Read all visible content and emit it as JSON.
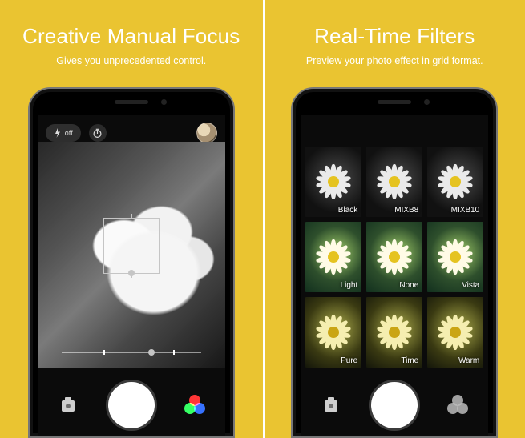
{
  "panels": [
    {
      "headline": "Creative Manual Focus",
      "subline": "Gives you unprecedented control.",
      "flash_label": "off"
    },
    {
      "headline": "Real-Time Filters",
      "subline": "Preview your photo effect in grid format."
    }
  ],
  "filters": [
    {
      "label": "Black",
      "tone": "dark"
    },
    {
      "label": "MIXB8",
      "tone": "dark"
    },
    {
      "label": "MIXB10",
      "tone": "dark"
    },
    {
      "label": "Light",
      "tone": "color"
    },
    {
      "label": "None",
      "tone": "color"
    },
    {
      "label": "Vista",
      "tone": "color"
    },
    {
      "label": "Pure",
      "tone": "warm"
    },
    {
      "label": "Time",
      "tone": "warm"
    },
    {
      "label": "Warm",
      "tone": "warm"
    }
  ]
}
